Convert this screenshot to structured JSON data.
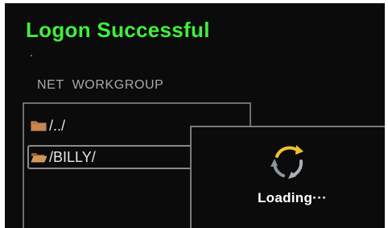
{
  "header": {
    "title": "Logon Successful"
  },
  "location": {
    "path_label": "NET  WORKGROUP"
  },
  "browser": {
    "items": [
      {
        "label": "/../",
        "icon": "folder-icon",
        "selected": false
      },
      {
        "label": "/BILLY/",
        "icon": "folder-open-icon",
        "selected": true
      }
    ]
  },
  "dialog": {
    "message": "Loading···",
    "icon": "loading-spinner-icon"
  },
  "colors": {
    "title": "#3ff03a",
    "background": "#0b0b0b",
    "spinner_accent": "#f2c12e",
    "spinner_gray": "#a8b0b8"
  }
}
